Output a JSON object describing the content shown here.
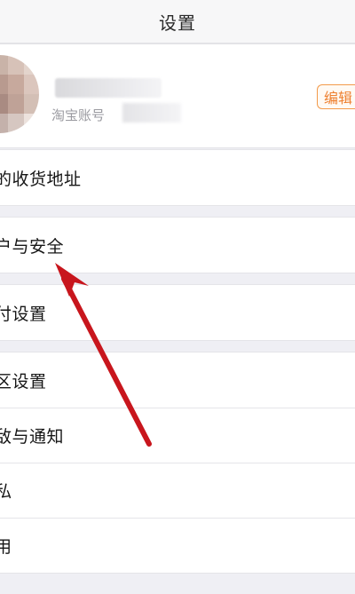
{
  "navbar": {
    "title": "设置"
  },
  "profile": {
    "account_label": "淘宝账号",
    "edit_label": "编辑"
  },
  "menu": {
    "address": "的收货地址",
    "security": "户与安全",
    "payment": "付设置",
    "region": "区设置",
    "message": "敌与通知",
    "privacy": "私",
    "general": "用"
  },
  "colors": {
    "accent_orange": "#ee8030",
    "annotation_arrow": "#c8161d",
    "background": "#efeff4"
  }
}
